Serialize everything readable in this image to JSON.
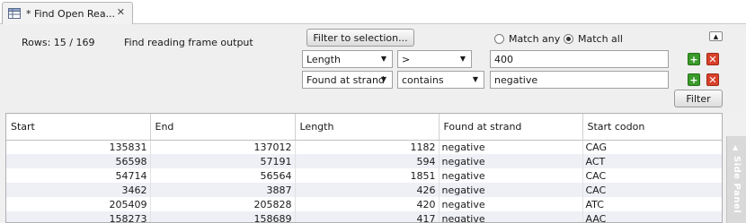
{
  "tab": {
    "title": "* Find Open Rea...",
    "close": "✕",
    "icon": "table-icon"
  },
  "panel": {
    "rows": "Rows: 15 / 169",
    "output": "Find reading frame output",
    "filter_selection": "Filter to selection...",
    "match_any": "Match any",
    "match_all": "Match all",
    "match_selected": "all",
    "filter_button": "Filter",
    "collapse": "▲"
  },
  "filters": [
    {
      "column": "Length",
      "operator": ">",
      "value": "400"
    },
    {
      "column": "Found at strand",
      "operator": "contains",
      "value": "negative"
    }
  ],
  "table": {
    "headers": [
      "Start",
      "End",
      "Length",
      "Found at strand",
      "Start codon"
    ],
    "rows": [
      [
        "135831",
        "137012",
        "1182",
        "negative",
        "CAG"
      ],
      [
        "56598",
        "57191",
        "594",
        "negative",
        "ACT"
      ],
      [
        "54714",
        "56564",
        "1851",
        "negative",
        "CAC"
      ],
      [
        "3462",
        "3887",
        "426",
        "negative",
        "CAC"
      ],
      [
        "205409",
        "205828",
        "420",
        "negative",
        "ATC"
      ],
      [
        "158273",
        "158689",
        "417",
        "negative",
        "AAC"
      ]
    ]
  },
  "side_panel": {
    "label": "Side Panel"
  }
}
